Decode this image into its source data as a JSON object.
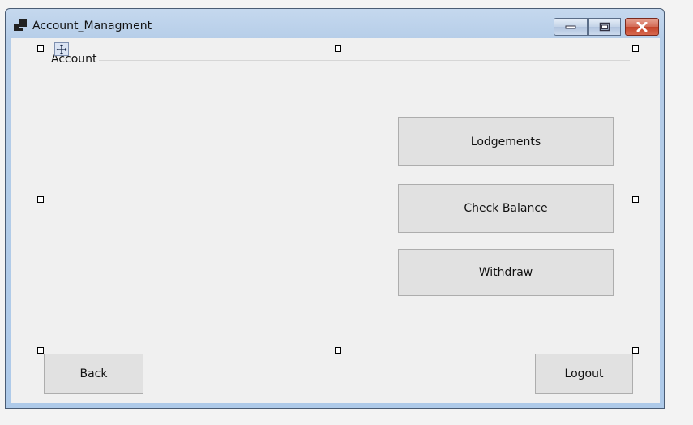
{
  "window": {
    "title": "Account_Managment"
  },
  "titlebar_buttons": {
    "minimize_icon": "minimize-icon",
    "maximize_icon": "maximize-icon",
    "close_icon": "close-icon"
  },
  "groupbox": {
    "label": "Account"
  },
  "actions": {
    "lodgements": "Lodgements",
    "check_balance": "Check Balance",
    "withdraw": "Withdraw"
  },
  "nav": {
    "back": "Back",
    "logout": "Logout"
  },
  "colors": {
    "close_button": "#c3432a",
    "form_background": "#f0f0f0",
    "button_face": "#e1e1e1"
  }
}
